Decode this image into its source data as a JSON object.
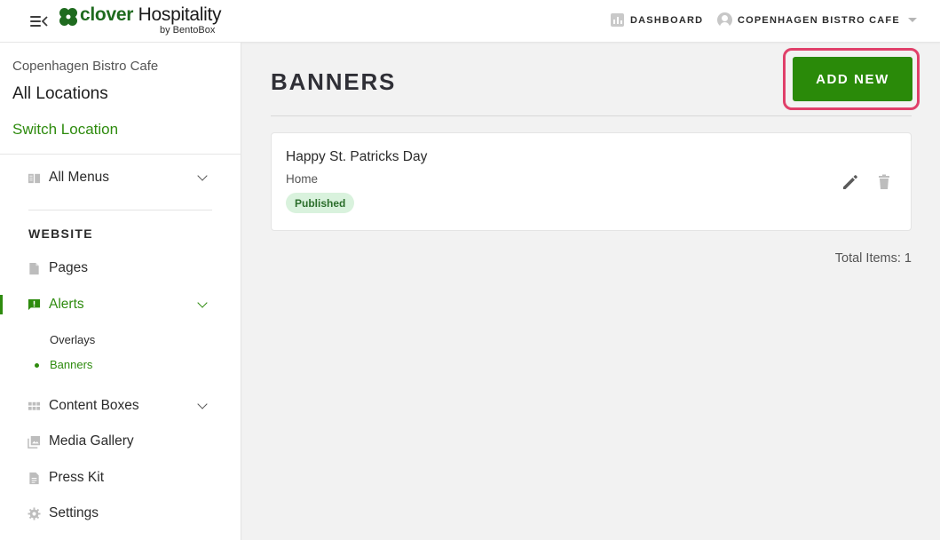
{
  "app": {
    "brand_primary": "clover",
    "brand_secondary": "Hospitality",
    "brand_sub": "by BentoBox",
    "accent_color": "#2a8a09",
    "highlight_color": "#e0406a"
  },
  "topbar": {
    "menu_icon": "menu-collapse-icon",
    "dashboard_label": "DASHBOARD",
    "location_label": "COPENHAGEN BISTRO CAFE"
  },
  "sidebar": {
    "location_name": "Copenhagen Bistro Cafe",
    "all_locations": "All Locations",
    "switch_location": "Switch Location",
    "all_menus": "All Menus",
    "section_title": "WEBSITE",
    "items": [
      {
        "label": "Pages",
        "icon": "page-icon"
      },
      {
        "label": "Alerts",
        "icon": "alert-icon",
        "active": true
      },
      {
        "label": "Content Boxes",
        "icon": "grid-icon"
      },
      {
        "label": "Media Gallery",
        "icon": "gallery-icon"
      },
      {
        "label": "Press Kit",
        "icon": "document-icon"
      },
      {
        "label": "Settings",
        "icon": "gear-icon"
      }
    ],
    "alerts_sub": [
      {
        "label": "Overlays"
      },
      {
        "label": "Banners",
        "active": true
      }
    ]
  },
  "main": {
    "title": "BANNERS",
    "add_button": "ADD NEW",
    "banners": [
      {
        "title": "Happy St. Patricks Day",
        "page": "Home",
        "status": "Published"
      }
    ],
    "total_items": "Total Items: 1"
  }
}
